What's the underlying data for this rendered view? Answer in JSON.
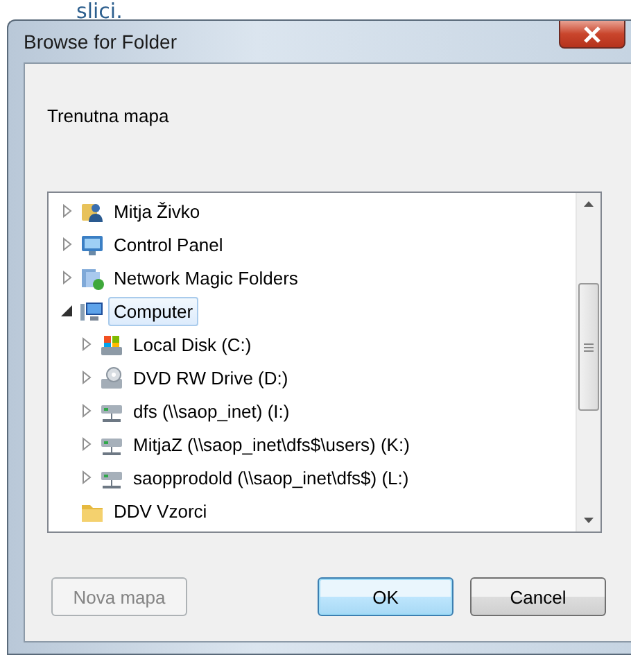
{
  "caption": "slici.",
  "window": {
    "title": "Browse for Folder"
  },
  "description": "Trenutna mapa",
  "tree": [
    {
      "label": "Mitja Živko",
      "kind": "user-folder",
      "expandable": true,
      "expanded": false,
      "selected": false
    },
    {
      "label": "Control Panel",
      "kind": "control-panel",
      "expandable": true,
      "expanded": false,
      "selected": false
    },
    {
      "label": "Network Magic Folders",
      "kind": "network-folder",
      "expandable": true,
      "expanded": false,
      "selected": false
    },
    {
      "label": "Computer",
      "kind": "computer",
      "expandable": true,
      "expanded": true,
      "selected": true,
      "children": [
        {
          "label": "Local Disk (C:)",
          "kind": "local-disk",
          "expandable": true,
          "expanded": false,
          "selected": false
        },
        {
          "label": "DVD RW Drive (D:)",
          "kind": "dvd-drive",
          "expandable": true,
          "expanded": false,
          "selected": false
        },
        {
          "label": "dfs (\\\\saop_inet) (I:)",
          "kind": "network-drive",
          "expandable": true,
          "expanded": false,
          "selected": false
        },
        {
          "label": "MitjaZ (\\\\saop_inet\\dfs$\\users) (K:)",
          "kind": "network-drive",
          "expandable": true,
          "expanded": false,
          "selected": false
        },
        {
          "label": "saopprodold (\\\\saop_inet\\dfs$) (L:)",
          "kind": "network-drive",
          "expandable": true,
          "expanded": false,
          "selected": false
        }
      ]
    },
    {
      "label": "DDV Vzorci",
      "kind": "folder",
      "expandable": false,
      "selected": false
    }
  ],
  "buttons": [
    {
      "label": "Nova mapa",
      "disabled": true,
      "default": false
    },
    {
      "label": "OK",
      "disabled": false,
      "default": true
    },
    {
      "label": "Cancel",
      "disabled": false,
      "default": false
    }
  ]
}
